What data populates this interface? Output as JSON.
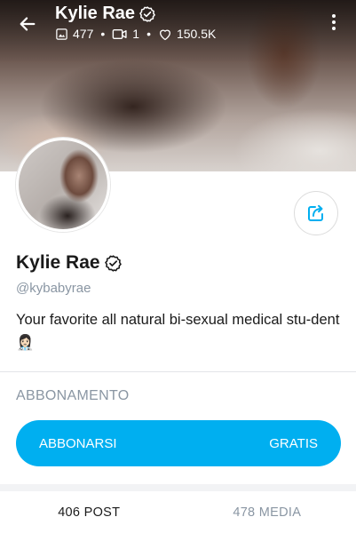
{
  "header": {
    "name": "Kylie Rae",
    "stats": {
      "photos": "477",
      "videos": "1",
      "likes": "150.5K"
    },
    "separator": "•"
  },
  "profile": {
    "name": "Kylie Rae",
    "handle": "@kybabyrae",
    "bio": "Your favorite all natural bi-sexual medical stu-dent 👩🏻‍⚕️"
  },
  "subscription": {
    "section_title": "ABBONAMENTO",
    "button_label": "ABBONARSI",
    "button_price": "GRATIS"
  },
  "tabs": {
    "posts": "406 POST",
    "media": "478 MEDIA"
  },
  "colors": {
    "accent": "#00aff0",
    "muted": "#8a96a3"
  }
}
